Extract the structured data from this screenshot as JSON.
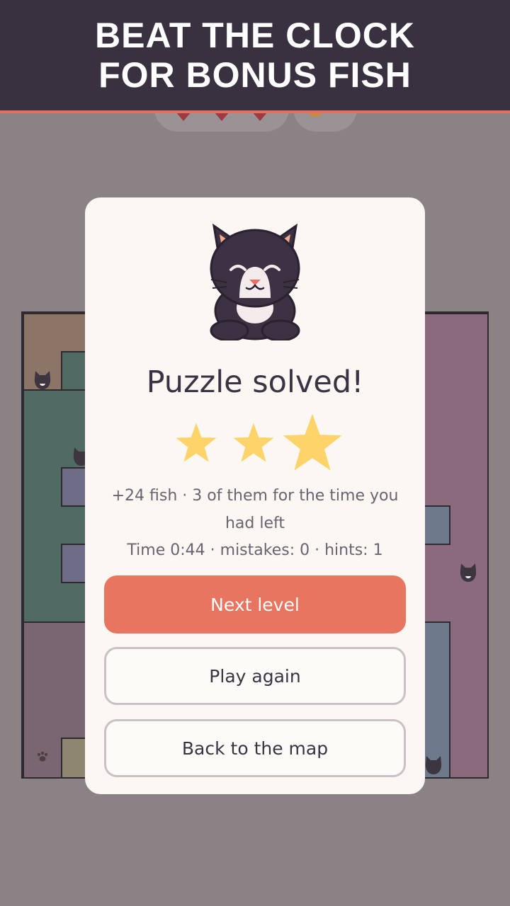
{
  "banner": {
    "line1": "BEAT THE CLOCK",
    "line2": "FOR BONUS FISH"
  },
  "hud": {
    "hearts_icon": "heart-icon",
    "coin_icon": "coin-icon"
  },
  "board": {
    "cat_icon": "cat-icon",
    "paw_icon": "paw-icon"
  },
  "dialog": {
    "mascot_icon": "cat-mascot-icon",
    "title": "Puzzle solved!",
    "stars_earned": 3,
    "stars_total": 3,
    "reward_text": "+24 fish · 3 of them for the time you had left",
    "stats_text": "Time 0:44 · mistakes: 0 · hints: 1",
    "buttons": {
      "next": "Next level",
      "again": "Play again",
      "map": "Back to the map"
    }
  },
  "colors": {
    "banner_bg": "#3a3140",
    "banner_border": "#e07060",
    "overlay_bg": "#8b8285",
    "dialog_bg": "#fbf8f3",
    "primary_button": "#e87560",
    "star": "#fdd36a",
    "title_text": "#3a3343"
  }
}
